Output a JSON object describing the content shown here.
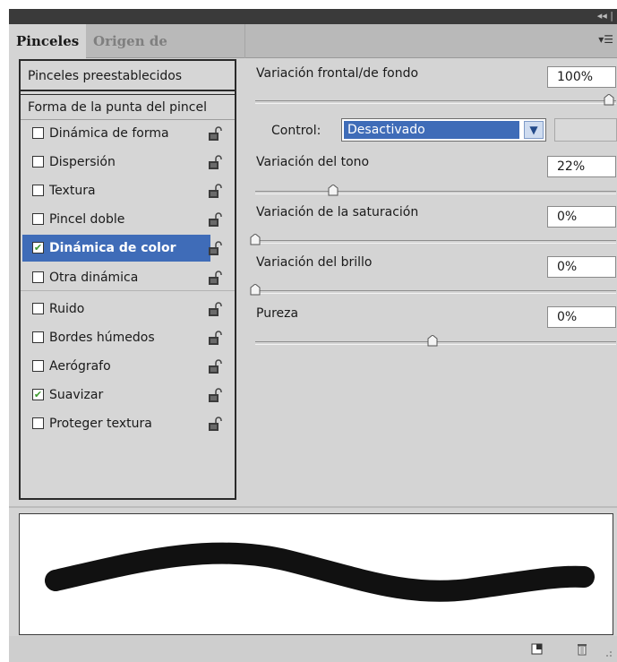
{
  "tabs": [
    {
      "label": "Pinceles"
    },
    {
      "label": "Origen de clonación"
    }
  ],
  "left_panel": {
    "presets_label": "Pinceles preestablecidos",
    "tip_shape_label": "Forma de la punta del pincel",
    "items": [
      {
        "label": "Dinámica de forma",
        "checked": false
      },
      {
        "label": "Dispersión",
        "checked": false
      },
      {
        "label": "Textura",
        "checked": false
      },
      {
        "label": "Pincel doble",
        "checked": false
      },
      {
        "label": "Dinámica de color",
        "checked": true,
        "selected": true
      },
      {
        "label": "Otra dinámica",
        "checked": false
      },
      {
        "label": "Ruido",
        "checked": false
      },
      {
        "label": "Bordes húmedos",
        "checked": false
      },
      {
        "label": "Aerógrafo",
        "checked": false
      },
      {
        "label": "Suavizar",
        "checked": true
      },
      {
        "label": "Proteger textura",
        "checked": false
      }
    ]
  },
  "settings": {
    "foreground_background": {
      "label": "Variación frontal/de fondo",
      "value": "100%",
      "level": 1.0
    },
    "control": {
      "label": "Control:",
      "selected": "Desactivado"
    },
    "hue": {
      "label": "Variación del tono",
      "value": "22%",
      "level": 0.22
    },
    "saturation": {
      "label": "Variación de la saturación",
      "value": "0%",
      "level": 0.0
    },
    "brightness": {
      "label": "Variación del brillo",
      "value": "0%",
      "level": 0.0
    },
    "purity": {
      "label": "Pureza",
      "value": "0%",
      "level": 0.5
    }
  },
  "colors": {
    "selection": "#3f6cb8",
    "panel": "#d4d4d4",
    "check": "#3d9a2d"
  },
  "icons": [
    "collapse-arrows-icon",
    "panel-menu-icon",
    "lock-icon",
    "new-brush-icon",
    "trash-icon",
    "resize-grip-icon"
  ]
}
